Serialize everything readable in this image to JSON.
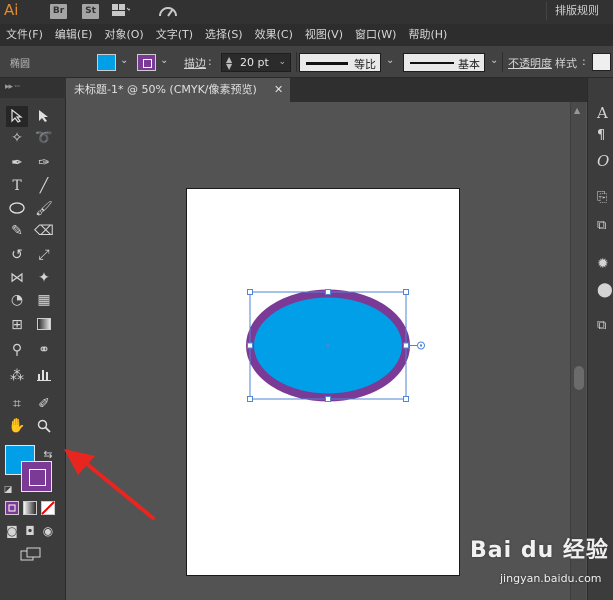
{
  "titlebar": {
    "logo": "Ai",
    "badges": [
      "Br",
      "St"
    ],
    "workspace": "排版规则"
  },
  "menu": [
    "文件(F)",
    "编辑(E)",
    "对象(O)",
    "文字(T)",
    "选择(S)",
    "效果(C)",
    "视图(V)",
    "窗口(W)",
    "帮助(H)"
  ],
  "controlbar": {
    "selection_label": "椭圆",
    "stroke_label": "描边",
    "stroke_weight": "20 pt",
    "profile_label": "等比",
    "brush_label": "基本",
    "opacity_label": "不透明度",
    "style_label": "样式",
    "fill_color": "#009fe8",
    "stroke_color": "#7b3a95"
  },
  "document": {
    "tab_title": "未标题-1* @ 50% (CMYK/像素预览)"
  },
  "shape": {
    "type": "ellipse",
    "fill": "#009fe8",
    "stroke": "#7b3a95"
  },
  "watermark": {
    "brand": "Bai du 经验",
    "url": "jingyan.baidu.com"
  }
}
